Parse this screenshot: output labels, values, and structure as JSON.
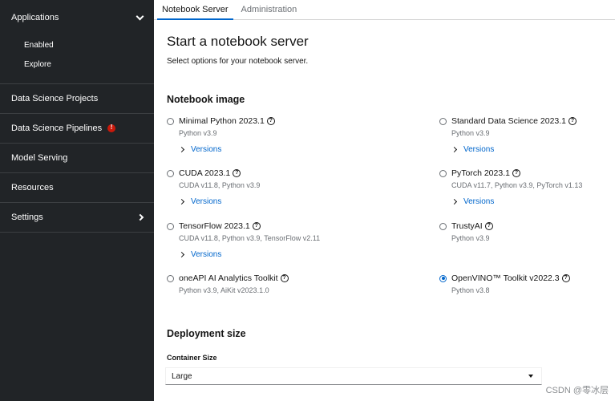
{
  "sidebar": {
    "applications": {
      "label": "Applications",
      "items": [
        "Enabled",
        "Explore"
      ]
    },
    "items": [
      {
        "label": "Data Science Projects"
      },
      {
        "label": "Data Science Pipelines"
      },
      {
        "label": "Model Serving"
      },
      {
        "label": "Resources"
      },
      {
        "label": "Settings"
      }
    ]
  },
  "tabs": [
    {
      "label": "Notebook Server",
      "active": true
    },
    {
      "label": "Administration",
      "active": false
    }
  ],
  "page": {
    "title": "Start a notebook server",
    "subtitle": "Select options for your notebook server."
  },
  "notebook_image": {
    "title": "Notebook image",
    "versions_label": "Versions",
    "options": [
      {
        "name": "Minimal Python 2023.1",
        "desc": "Python v3.9",
        "versions": true,
        "checked": false
      },
      {
        "name": "Standard Data Science 2023.1",
        "desc": "Python v3.9",
        "versions": true,
        "checked": false
      },
      {
        "name": "CUDA 2023.1",
        "desc": "CUDA v11.8, Python v3.9",
        "versions": true,
        "checked": false
      },
      {
        "name": "PyTorch 2023.1",
        "desc": "CUDA v11.7, Python v3.9, PyTorch v1.13",
        "versions": true,
        "checked": false
      },
      {
        "name": "TensorFlow 2023.1",
        "desc": "CUDA v11.8, Python v3.9, TensorFlow v2.11",
        "versions": true,
        "checked": false
      },
      {
        "name": "TrustyAI",
        "desc": "Python v3.9",
        "versions": false,
        "checked": false
      },
      {
        "name": "oneAPI AI Analytics Toolkit",
        "desc": "Python v3.9, AiKit v2023.1.0",
        "versions": false,
        "checked": false
      },
      {
        "name": "OpenVINO™ Toolkit v2022.3",
        "desc": "Python v3.8",
        "versions": false,
        "checked": true
      }
    ]
  },
  "deployment": {
    "title": "Deployment size",
    "container_size_label": "Container Size",
    "container_size_value": "Large"
  },
  "watermark": "CSDN @零冰层",
  "colors": {
    "sidebar_bg": "#212427",
    "accent": "#0066cc",
    "alert": "#c9190b"
  }
}
